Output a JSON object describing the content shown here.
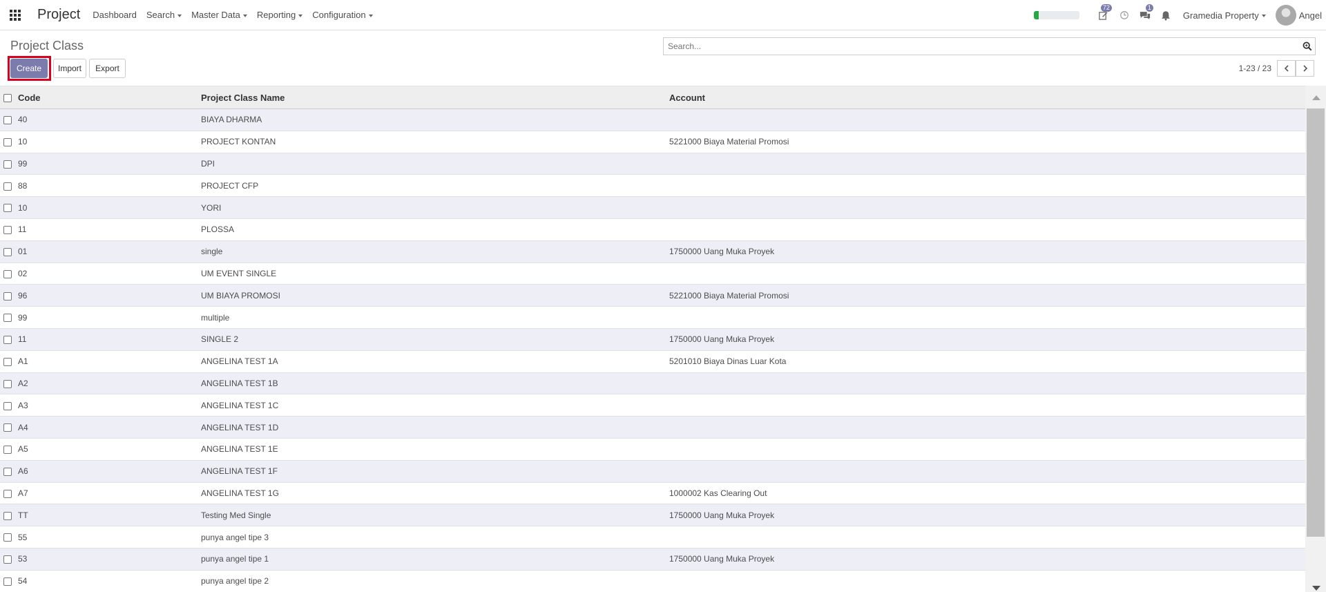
{
  "navbar": {
    "app_title": "Project",
    "menus": [
      {
        "label": "Dashboard",
        "has_dropdown": false
      },
      {
        "label": "Search",
        "has_dropdown": true
      },
      {
        "label": "Master Data",
        "has_dropdown": true
      },
      {
        "label": "Reporting",
        "has_dropdown": true
      },
      {
        "label": "Configuration",
        "has_dropdown": true
      }
    ],
    "activity_badge": "72",
    "messages_badge": "1",
    "progress_fraction": 0.1,
    "company": "Gramedia Property",
    "user": "Angel"
  },
  "control": {
    "title": "Project Class",
    "search_placeholder": "Search...",
    "create_label": "Create",
    "import_label": "Import",
    "export_label": "Export",
    "pager": "1-23 / 23"
  },
  "table": {
    "headers": {
      "code": "Code",
      "name": "Project Class Name",
      "account": "Account"
    },
    "rows": [
      {
        "code": "40",
        "name": "BIAYA DHARMA",
        "account": ""
      },
      {
        "code": "10",
        "name": "PROJECT KONTAN",
        "account": "5221000 Biaya Material Promosi"
      },
      {
        "code": "99",
        "name": "DPI",
        "account": ""
      },
      {
        "code": "88",
        "name": "PROJECT CFP",
        "account": ""
      },
      {
        "code": "10",
        "name": "YORI",
        "account": ""
      },
      {
        "code": "11",
        "name": "PLOSSA",
        "account": ""
      },
      {
        "code": "01",
        "name": "single",
        "account": "1750000 Uang Muka Proyek"
      },
      {
        "code": "02",
        "name": "UM EVENT SINGLE",
        "account": ""
      },
      {
        "code": "96",
        "name": "UM BIAYA PROMOSI",
        "account": "5221000 Biaya Material Promosi"
      },
      {
        "code": "99",
        "name": "multiple",
        "account": ""
      },
      {
        "code": "11",
        "name": "SINGLE 2",
        "account": "1750000 Uang Muka Proyek"
      },
      {
        "code": "A1",
        "name": "ANGELINA TEST 1A",
        "account": "5201010 Biaya Dinas Luar Kota"
      },
      {
        "code": "A2",
        "name": "ANGELINA TEST 1B",
        "account": ""
      },
      {
        "code": "A3",
        "name": "ANGELINA TEST 1C",
        "account": ""
      },
      {
        "code": "A4",
        "name": "ANGELINA TEST 1D",
        "account": ""
      },
      {
        "code": "A5",
        "name": "ANGELINA TEST 1E",
        "account": ""
      },
      {
        "code": "A6",
        "name": "ANGELINA TEST 1F",
        "account": ""
      },
      {
        "code": "A7",
        "name": "ANGELINA TEST 1G",
        "account": "1000002 Kas Clearing Out"
      },
      {
        "code": "TT",
        "name": "Testing Med Single",
        "account": "1750000 Uang Muka Proyek"
      },
      {
        "code": "55",
        "name": "punya angel tipe 3",
        "account": ""
      },
      {
        "code": "53",
        "name": "punya angel tipe 1",
        "account": "1750000 Uang Muka Proyek"
      },
      {
        "code": "54",
        "name": "punya angel tipe 2",
        "account": ""
      }
    ]
  }
}
